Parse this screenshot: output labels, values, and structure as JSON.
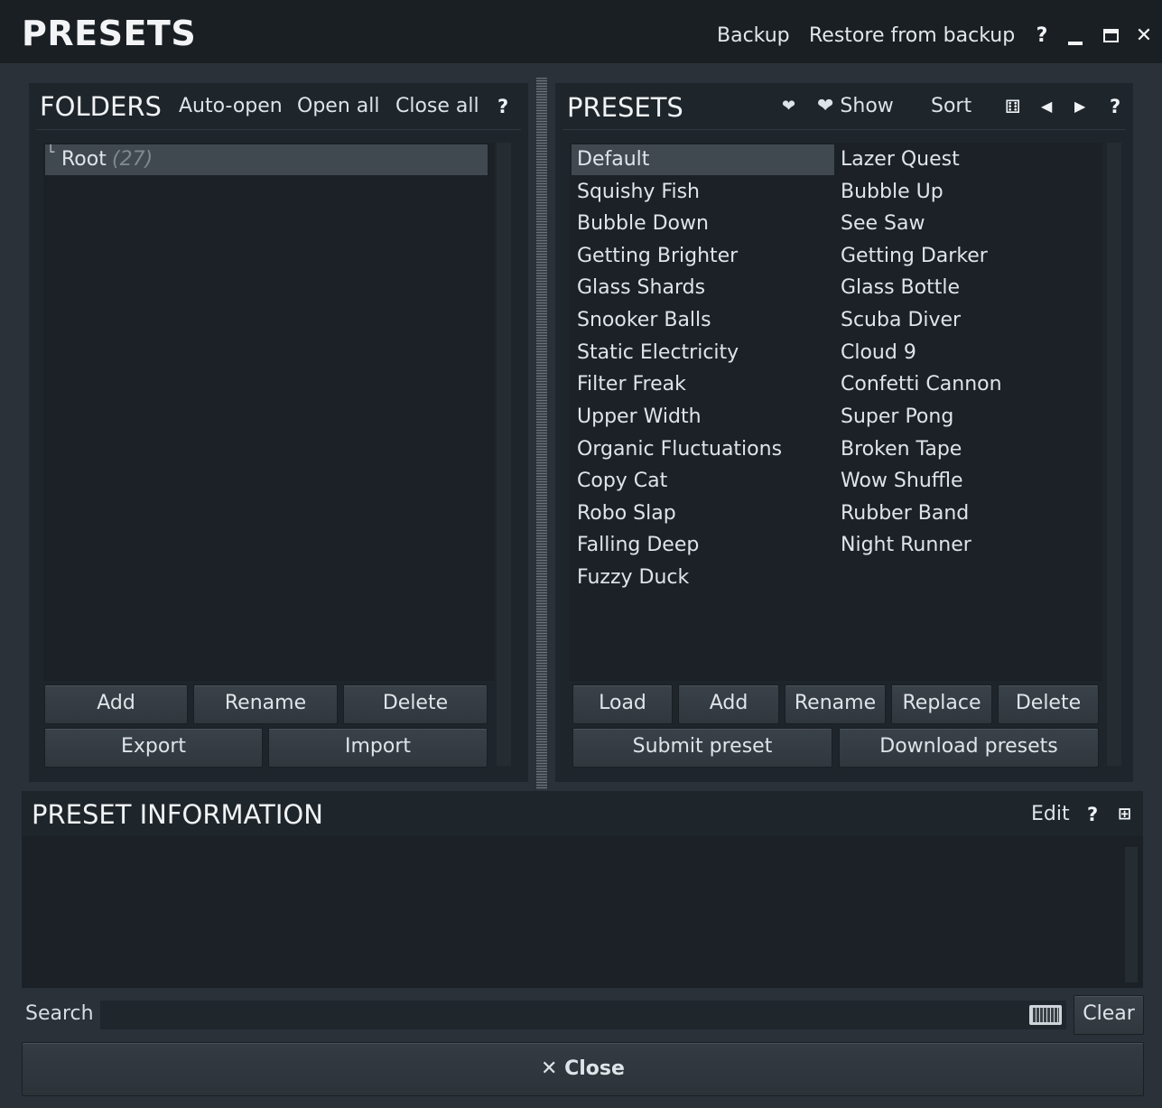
{
  "titlebar": {
    "title": "PRESETS",
    "backup": "Backup",
    "restore": "Restore from backup",
    "help": "?",
    "minimize": "–",
    "maximize": "□",
    "close": "✕"
  },
  "folders": {
    "title": "FOLDERS",
    "auto_open": "Auto-open",
    "open_all": "Open all",
    "close_all": "Close all",
    "help": "?",
    "tree_prefix": "└",
    "root_label": "Root",
    "root_count": "(27)",
    "buttons": {
      "add": "Add",
      "rename": "Rename",
      "delete": "Delete",
      "export": "Export",
      "import": "Import"
    }
  },
  "presets": {
    "title": "PRESETS",
    "heart": "❤",
    "show": "❤ Show",
    "sort": "Sort",
    "random": "⚅",
    "prev": "◀",
    "next": "▶",
    "help": "?",
    "selected": "Default",
    "column1": [
      "Default",
      "Squishy Fish",
      "Bubble Down",
      "Getting Brighter",
      "Glass Shards",
      "Snooker Balls",
      "Static Electricity",
      "Filter Freak",
      "Upper Width",
      "Organic Fluctuations",
      "Copy Cat",
      "Robo Slap",
      "Falling Deep",
      "Fuzzy Duck"
    ],
    "column2": [
      "Lazer Quest",
      "Bubble Up",
      "See Saw",
      "Getting Darker",
      "Glass Bottle",
      "Scuba Diver",
      "Cloud 9",
      "Confetti Cannon",
      "Super Pong",
      "Broken Tape",
      "Wow Shuffle",
      "Rubber Band",
      "Night Runner"
    ],
    "buttons": {
      "load": "Load",
      "add": "Add",
      "rename": "Rename",
      "replace": "Replace",
      "delete": "Delete",
      "submit": "Submit preset",
      "download": "Download presets"
    }
  },
  "info": {
    "title": "PRESET INFORMATION",
    "edit": "Edit",
    "help": "?",
    "expand": "⊞"
  },
  "search": {
    "label": "Search",
    "value": "",
    "keyboard": "⌨",
    "clear": "Clear"
  },
  "footer": {
    "close": "✕ Close"
  }
}
